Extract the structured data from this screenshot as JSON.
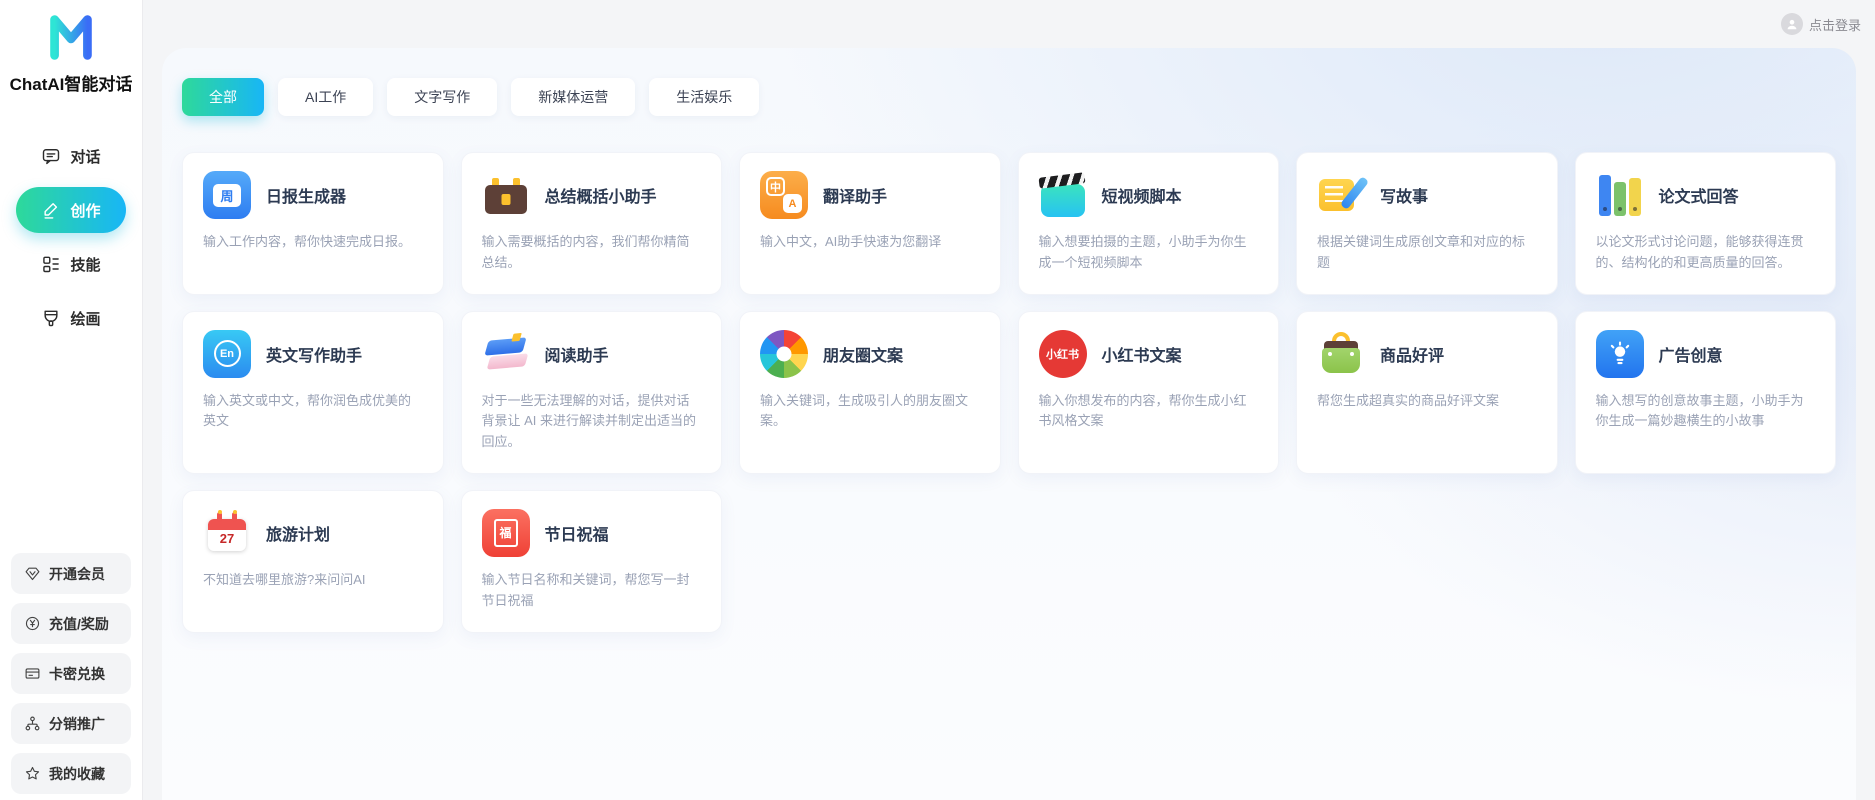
{
  "app": {
    "brand": "ChatAI智能对话",
    "login_label": "点击登录"
  },
  "sidebar": {
    "nav": [
      {
        "label": "对话"
      },
      {
        "label": "创作"
      },
      {
        "label": "技能"
      },
      {
        "label": "绘画"
      }
    ],
    "utils": [
      {
        "label": "开通会员"
      },
      {
        "label": "充值/奖励"
      },
      {
        "label": "卡密兑换"
      },
      {
        "label": "分销推广"
      },
      {
        "label": "我的收藏"
      }
    ]
  },
  "tabs": [
    {
      "label": "全部",
      "active": true
    },
    {
      "label": "AI工作",
      "active": false
    },
    {
      "label": "文字写作",
      "active": false
    },
    {
      "label": "新媒体运营",
      "active": false
    },
    {
      "label": "生活娱乐",
      "active": false
    }
  ],
  "cards": [
    {
      "icon": "daily-report",
      "icon_text": "周",
      "title": "日报生成器",
      "desc": "输入工作内容，帮你快速完成日报。"
    },
    {
      "icon": "summary-briefcase",
      "title": "总结概括小助手",
      "desc": "输入需要概括的内容，我们帮你精简总结。"
    },
    {
      "icon": "translate",
      "icon_text_cn": "中",
      "icon_text_en": "A",
      "title": "翻译助手",
      "desc": "输入中文，AI助手快速为您翻译"
    },
    {
      "icon": "short-video",
      "title": "短视频脚本",
      "desc": "输入想要拍摄的主题，小助手为你生成一个短视频脚本"
    },
    {
      "icon": "story-note",
      "title": "写故事",
      "desc": "根据关键词生成原创文章和对应的标题"
    },
    {
      "icon": "essay-binders",
      "title": "论文式回答",
      "desc": "以论文形式讨论问题，能够获得连贯的、结构化的和更高质量的回答。"
    },
    {
      "icon": "english-writing",
      "icon_text": "En",
      "title": "英文写作助手",
      "desc": "输入英文或中文，帮你润色成优美的英文"
    },
    {
      "icon": "reading-books",
      "title": "阅读助手",
      "desc": "对于一些无法理解的对话，提供对话背景让 AI 来进行解读并制定出适当的回应。"
    },
    {
      "icon": "moments-pinwheel",
      "title": "朋友圈文案",
      "desc": "输入关键词，生成吸引人的朋友圈文案。"
    },
    {
      "icon": "xiaohongshu",
      "icon_text": "小红书",
      "title": "小红书文案",
      "desc": "输入你想发布的内容，帮你生成小红书风格文案"
    },
    {
      "icon": "shopping-bag",
      "title": "商品好评",
      "desc": "帮您生成超真实的商品好评文案"
    },
    {
      "icon": "lightbulb",
      "title": "广告创意",
      "desc": "输入想写的创意故事主题，小助手为你生成一篇妙趣横生的小故事"
    },
    {
      "icon": "travel-calendar",
      "icon_text": "27",
      "title": "旅游计划",
      "desc": "不知道去哪里旅游?来问问AI"
    },
    {
      "icon": "festival-fu",
      "icon_text": "福",
      "title": "节日祝福",
      "desc": "输入节日名称和关键词，帮您写一封节日祝福"
    }
  ],
  "colors": {
    "accent_gradient_start": "#2ed99a",
    "accent_gradient_end": "#18b6f6",
    "logo_gradient_start": "#2ee5d5",
    "logo_gradient_end": "#3a6df6",
    "panel_tint": "#dde8f8",
    "card_title": "#2c3a52",
    "card_desc": "#9aa2b5"
  }
}
